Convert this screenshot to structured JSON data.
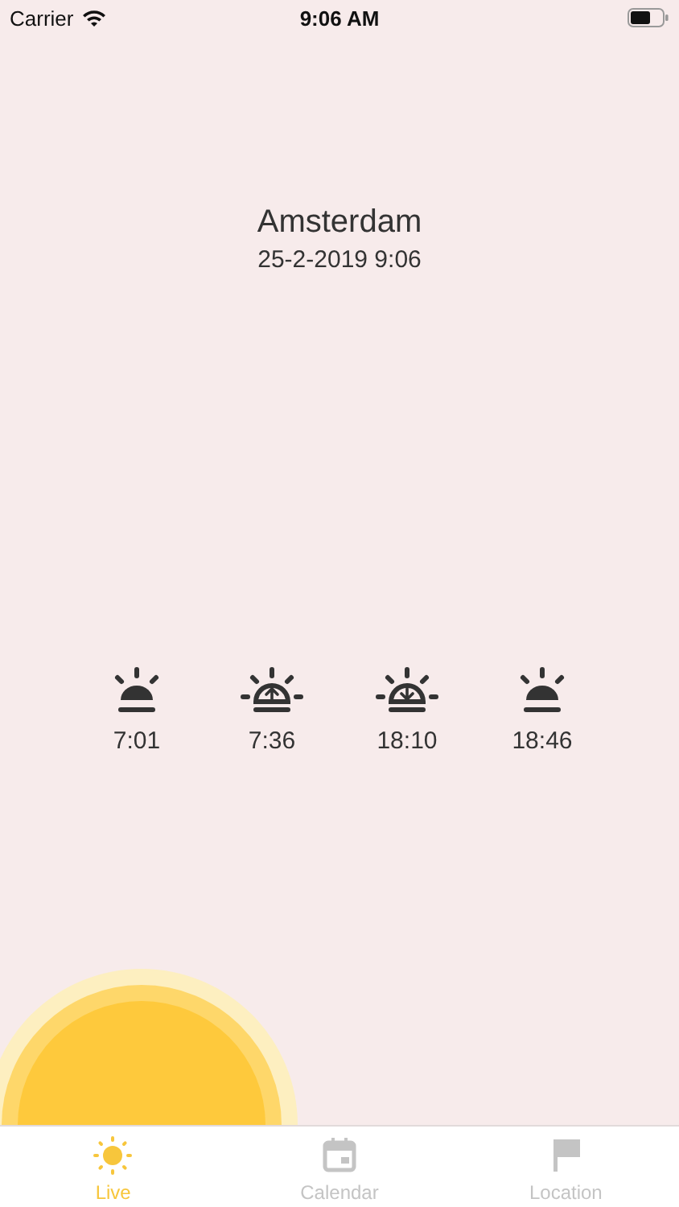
{
  "status_bar": {
    "carrier": "Carrier",
    "time": "9:06 AM"
  },
  "location": {
    "city": "Amsterdam",
    "datetime": "25-2-2019 9:06"
  },
  "sun_times": [
    {
      "kind": "plain",
      "time": "7:01"
    },
    {
      "kind": "up",
      "time": "7:36"
    },
    {
      "kind": "down",
      "time": "18:10"
    },
    {
      "kind": "plain",
      "time": "18:46"
    }
  ],
  "tabs": [
    {
      "kind": "sun",
      "label": "Live",
      "selected": true
    },
    {
      "kind": "calendar",
      "label": "Calendar",
      "selected": false
    },
    {
      "kind": "flag",
      "label": "Location",
      "selected": false
    }
  ]
}
